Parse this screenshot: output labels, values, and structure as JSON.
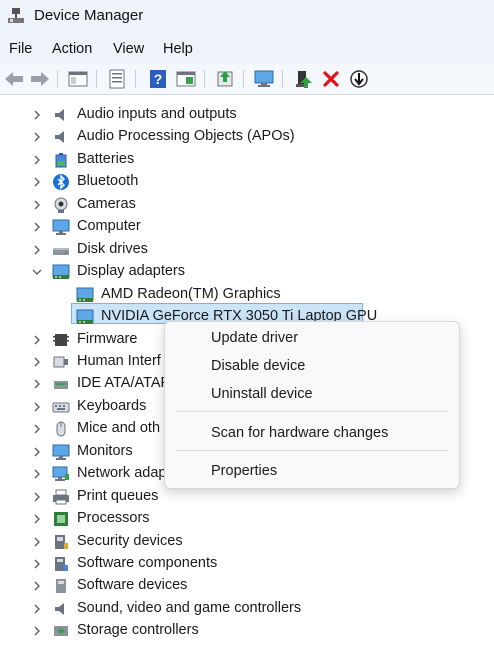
{
  "window": {
    "title": "Device Manager",
    "icon": "device-manager-icon"
  },
  "menubar": {
    "items": [
      "File",
      "Action",
      "View",
      "Help"
    ]
  },
  "toolbar": {
    "buttons": [
      "back-icon",
      "forward-icon",
      "show-hide-tree-icon",
      "properties-icon",
      "help-icon",
      "view-icon",
      "update-driver-icon",
      "scan-hardware-icon",
      "enable-device-icon",
      "uninstall-icon",
      "disable-icon"
    ]
  },
  "tree": {
    "items": [
      {
        "label": "Audio inputs and outputs",
        "icon": "speaker-icon",
        "expanded": false
      },
      {
        "label": "Audio Processing Objects (APOs)",
        "icon": "speaker-icon",
        "expanded": false
      },
      {
        "label": "Batteries",
        "icon": "battery-icon",
        "expanded": false
      },
      {
        "label": "Bluetooth",
        "icon": "bluetooth-icon",
        "expanded": false
      },
      {
        "label": "Cameras",
        "icon": "camera-icon",
        "expanded": false
      },
      {
        "label": "Computer",
        "icon": "monitor-icon",
        "expanded": false
      },
      {
        "label": "Disk drives",
        "icon": "disk-icon",
        "expanded": false
      },
      {
        "label": "Display adapters",
        "icon": "display-adapter-icon",
        "expanded": true
      },
      {
        "label": "AMD Radeon(TM) Graphics",
        "icon": "display-adapter-icon",
        "child": true
      },
      {
        "label": "NVIDIA GeForce RTX 3050 Ti Laptop GPU",
        "icon": "display-adapter-icon",
        "child": true,
        "selected": true
      },
      {
        "label": "Firmware",
        "icon": "chip-icon",
        "expanded": false
      },
      {
        "label": "Human Interf",
        "icon": "hid-icon",
        "expanded": false
      },
      {
        "label": "IDE ATA/ATAPI",
        "icon": "ide-icon",
        "expanded": false
      },
      {
        "label": "Keyboards",
        "icon": "keyboard-icon",
        "expanded": false
      },
      {
        "label": "Mice and oth",
        "icon": "mouse-icon",
        "expanded": false
      },
      {
        "label": "Monitors",
        "icon": "monitor-icon",
        "expanded": false
      },
      {
        "label": "Network adap",
        "icon": "network-icon",
        "expanded": false
      },
      {
        "label": "Print queues",
        "icon": "printer-icon",
        "expanded": false
      },
      {
        "label": "Processors",
        "icon": "processor-icon",
        "expanded": false
      },
      {
        "label": "Security devices",
        "icon": "security-icon",
        "expanded": false
      },
      {
        "label": "Software components",
        "icon": "software-component-icon",
        "expanded": false
      },
      {
        "label": "Software devices",
        "icon": "software-device-icon",
        "expanded": false
      },
      {
        "label": "Sound, video and game controllers",
        "icon": "speaker-icon",
        "expanded": false
      },
      {
        "label": "Storage controllers",
        "icon": "storage-icon",
        "expanded": false
      }
    ]
  },
  "context_menu": {
    "items": [
      "Update driver",
      "Disable device",
      "Uninstall device",
      "Scan for hardware changes",
      "Properties"
    ]
  },
  "colors": {
    "chrome_bg": "#eef3fa",
    "selection_bg": "#cce4f7",
    "selection_border": "#7ab1e0",
    "accent": "#0a64c8",
    "uninstall_red": "#e0121b"
  }
}
